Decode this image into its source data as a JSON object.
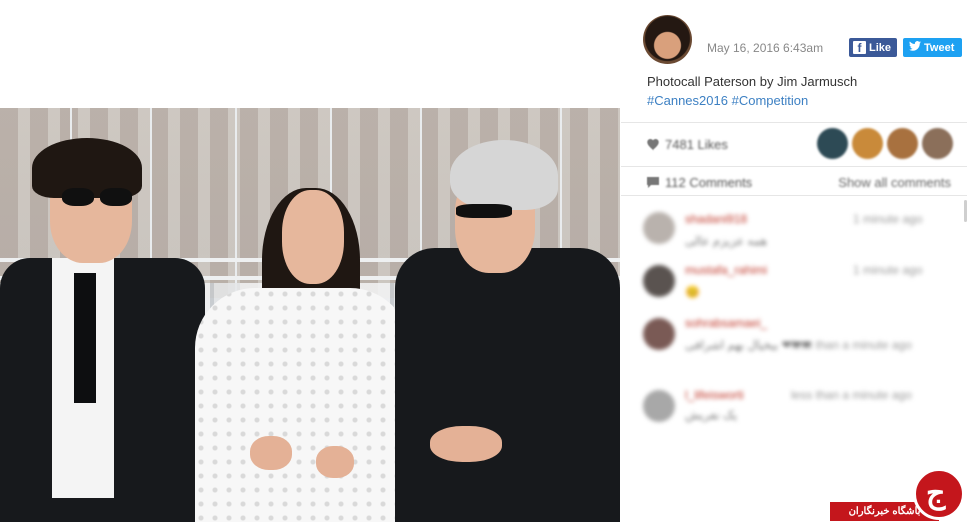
{
  "post": {
    "timestamp": "May 16, 2016 6:43am",
    "caption": "Photocall Paterson by Jim Jarmusch",
    "hashtags": [
      "#Cannes2016",
      "#Competition"
    ],
    "photo_alt": "photo"
  },
  "share": {
    "facebook_label": "Like",
    "twitter_label": "Tweet",
    "facebook_color": "#3b5998",
    "twitter_color": "#1da1f2"
  },
  "stats": {
    "likes": "7481 Likes",
    "comments": "112 Comments",
    "show_all": "Show all comments",
    "liker_colors": [
      "#2d4a55",
      "#c98a3a",
      "#a8713f",
      "#8b6f5a"
    ]
  },
  "comments": [
    {
      "user": "shadani918",
      "time": "1 minute ago",
      "text": "همه عزیزم عالی",
      "avatar_color": "#b9b2ad"
    },
    {
      "user": "mustafa_rahimi",
      "time": "1 minute ago",
      "text": "😊",
      "avatar_color": "#5a5350"
    },
    {
      "user": "sohrabsamaei_",
      "time": "less than a minute ago",
      "text": "بیخیال بهم اشرافی ❤❤❤",
      "avatar_color": "#7a5a55"
    },
    {
      "user": "l_lifeisworti",
      "time": "less than a minute ago",
      "text": "یک نفریش",
      "avatar_color": "#a8a8a8"
    }
  ],
  "watermark": {
    "label": "باشگاه خبرنگاران",
    "glyph": "ج",
    "color": "#c4161c"
  },
  "icons": {
    "heart": "heart-icon",
    "comment": "comment-icon",
    "facebook": "facebook-icon",
    "twitter": "twitter-icon"
  }
}
